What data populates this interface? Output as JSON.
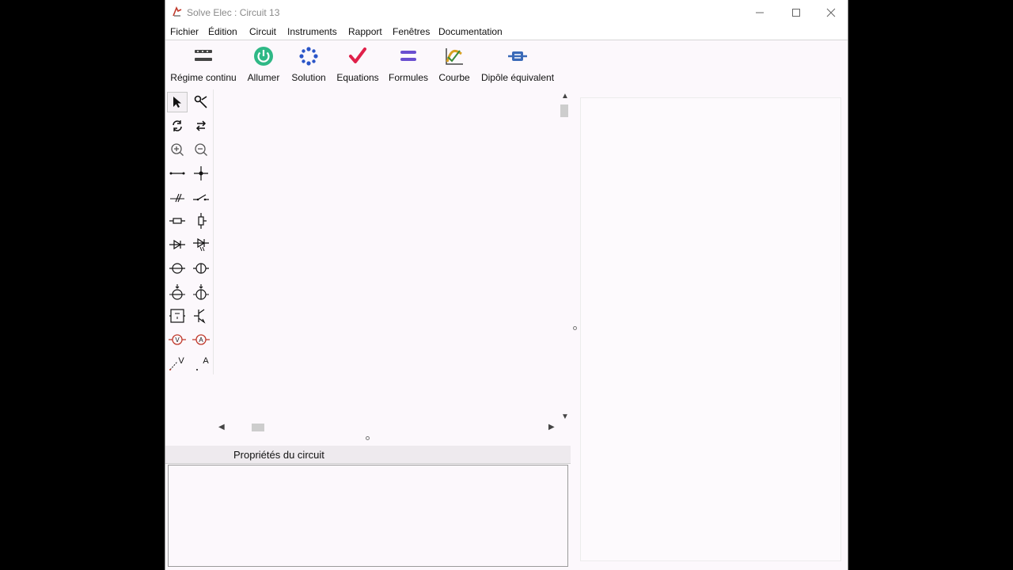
{
  "window": {
    "title": "Solve Elec : Circuit 13",
    "controls": {
      "minimize": "—",
      "maximize": "☐",
      "close": "✕"
    }
  },
  "menu": {
    "items": [
      {
        "label": "Fichier"
      },
      {
        "label": "Édition"
      },
      {
        "label": "Circuit"
      },
      {
        "label": "Instruments"
      },
      {
        "label": "Rapport"
      },
      {
        "label": "Fenêtres"
      },
      {
        "label": "Documentation"
      }
    ]
  },
  "toolbar": {
    "buttons": [
      {
        "label": "Régime continu",
        "icon": "dc-regime-icon"
      },
      {
        "label": "Allumer",
        "icon": "power-icon",
        "color": "#2aa87a"
      },
      {
        "label": "Solution",
        "icon": "solution-sparkle-icon",
        "color": "#2a55c8"
      },
      {
        "label": "Equations",
        "icon": "checkmark-icon",
        "color": "#e0204a"
      },
      {
        "label": "Formules",
        "icon": "formulas-equals-icon",
        "color": "#6a4fd0"
      },
      {
        "label": "Courbe",
        "icon": "curve-chart-icon",
        "color": "#d8a020"
      },
      {
        "label": "Dipôle équivalent",
        "icon": "dipole-icon",
        "color": "#3a6ab8"
      }
    ]
  },
  "palette": {
    "tools": [
      "select-arrow-icon",
      "wire-cutter-icon",
      "rotate-icon",
      "flip-icon",
      "zoom-in-icon",
      "zoom-out-icon",
      "wire-icon",
      "node-icon",
      "open-switch-icon",
      "closed-switch-icon",
      "resistor-horizontal-icon",
      "resistor-vertical-icon",
      "diode-icon",
      "led-icon",
      "lamp-icon",
      "lamp-vertical-icon",
      "voltage-source-icon",
      "current-source-icon",
      "generic-dipole-icon",
      "transistor-icon",
      "voltmeter-icon",
      "ammeter-icon",
      "voltage-probe-icon",
      "current-probe-icon"
    ],
    "meter_labels": {
      "voltmeter": "V",
      "ammeter": "A",
      "vprobe": "V",
      "aprobe": "A"
    }
  },
  "scroll": {
    "up": "▲",
    "down": "▼",
    "left": "◀",
    "right": "▶"
  },
  "properties": {
    "title": "Propriétés du circuit"
  }
}
